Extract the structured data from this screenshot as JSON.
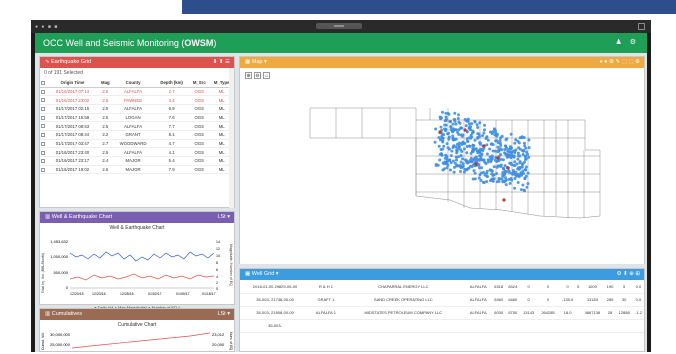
{
  "window": {
    "address": "owsm",
    "dots": "● ● ■ ■"
  },
  "app": {
    "title_prefix": "OCC Well and Seismic Monitoring (",
    "title_bold": "OWSM",
    "title_suffix": ")",
    "tools": "♟ ⚙"
  },
  "eq_grid": {
    "header": "Earthquake Grid",
    "header_tools": "⬇ ⬆ ☰",
    "selected": "0 of 191 Selected",
    "columns": [
      "",
      "Origin Time",
      "Mag",
      "County",
      "Depth (km)",
      "M_Src",
      "M_Type"
    ],
    "rows": [
      {
        "time": "01/16/2017 07:14",
        "mag": "2.5",
        "county": "ALFALFA",
        "depth": "2.7",
        "src": "OGS",
        "type": "ML",
        "alert": true
      },
      {
        "time": "01/16/2017 23:02",
        "mag": "2.6",
        "county": "PAWNEE",
        "depth": "3.4",
        "src": "OGS",
        "type": "ML",
        "alert": true
      },
      {
        "time": "01/17/2017 02:15",
        "mag": "2.5",
        "county": "ALFALFA",
        "depth": "6.9",
        "src": "OGS",
        "type": "ML",
        "alert": false
      },
      {
        "time": "01/17/2017 15:58",
        "mag": "2.6",
        "county": "LOGAN",
        "depth": "7.6",
        "src": "OGS",
        "type": "ML",
        "alert": false
      },
      {
        "time": "01/17/2017 08:53",
        "mag": "2.5",
        "county": "ALFALFA",
        "depth": "7.7",
        "src": "OGS",
        "type": "ML",
        "alert": false
      },
      {
        "time": "01/17/2017 08:44",
        "mag": "2.2",
        "county": "GRANT",
        "depth": "8.1",
        "src": "OGS",
        "type": "ML",
        "alert": false
      },
      {
        "time": "01/17/2017 03:47",
        "mag": "2.7",
        "county": "WOODWARD",
        "depth": "4.7",
        "src": "OGS",
        "type": "ML",
        "alert": false
      },
      {
        "time": "01/16/2017 23:40",
        "mag": "2.5",
        "county": "ALFALFA",
        "depth": "4.1",
        "src": "OGS",
        "type": "ML",
        "alert": false
      },
      {
        "time": "01/16/2017 23:17",
        "mag": "2.4",
        "county": "MAJOR",
        "depth": "5.4",
        "src": "OGS",
        "type": "ML",
        "alert": false
      },
      {
        "time": "01/16/2017 19:02",
        "mag": "2.6",
        "county": "MAJOR",
        "depth": "7.9",
        "src": "OGS",
        "type": "ML",
        "alert": false
      }
    ]
  },
  "we_chart": {
    "header": "Well & Earthquake Chart",
    "header_tools": "LSt ▾",
    "title": "Well & Earthquake Chart",
    "ylabel": "Total Inj. Vol. (BBL/Month)",
    "y2label": "Magnitude / Number of EQ",
    "yticks": [
      "1,453,632",
      "1,000,000",
      "500,000",
      "0"
    ],
    "y2ticks": [
      "14",
      "12",
      "10",
      "8",
      "6",
      "4",
      "2",
      "0"
    ],
    "xticks": [
      "12/20/15",
      "12/23/16",
      "12/28/16",
      "01/02/17",
      "01/09/17",
      "01/18/17"
    ],
    "legend": [
      "Daily Vol",
      "Max Magnitude*",
      "Number of EQ *"
    ]
  },
  "cum": {
    "header": "Cumulatives",
    "header_tools": "LSt ▾",
    "title": "Cumulative Chart",
    "ylabel": "Cumul. Vol.",
    "y2label": "Num. of EQ",
    "yticks": [
      "30,000,000",
      "25,000,000"
    ],
    "y2ticks": [
      "23,012",
      "20,000"
    ]
  },
  "map": {
    "header": "Map ▾",
    "header_tools": "● ● ⚙ ✎ ⬚ ⬚ ⚙",
    "zoom": [
      "⊕",
      "⊖",
      "⌂"
    ]
  },
  "well_grid": {
    "header": "Well Grid ▾",
    "header_tools": "⚙ ⬍ ⊕ ⊞",
    "rows": [
      {
        "date": "2016-01-00 29829-09-00",
        "name": "R & H 1",
        "op": "CHAPARRAL ENERGY LLC",
        "county": "ALFALFA",
        "a": "6318",
        "b": "8324",
        "c": "0",
        "d": "0",
        "e": "0",
        "f": "5",
        "g": "1009",
        "h": "190",
        "i": "5",
        "j": "0.0"
      },
      {
        "date": "35-003- 21748-00-00",
        "name": "GRAFT 1",
        "op": "SAND CREEK OPERATING LLC",
        "county": "ALFALFA",
        "a": "5460",
        "b": "6460",
        "c": "0",
        "d": "0",
        "e": "-135.9",
        "f": "",
        "g": "13183",
        "h": "289",
        "i": "30",
        "j": "0.0"
      },
      {
        "date": "35-003- 21808-00-00",
        "name": "ALFALFA 1",
        "op": "MIDSTATES PETROLEUM COMPANY LLC",
        "county": "ALFALFA",
        "a": "6030",
        "b": "8750",
        "c": "13143",
        "d": "264285",
        "e": "18.0",
        "f": "",
        "g": "4667138",
        "h": "28",
        "i": "12888",
        "j": "-1.2"
      },
      {
        "date": "35-003-",
        "name": "",
        "op": "",
        "county": "",
        "a": "",
        "b": "",
        "c": "",
        "d": "",
        "e": "",
        "f": "",
        "g": "",
        "h": "",
        "i": "",
        "j": ""
      }
    ]
  }
}
